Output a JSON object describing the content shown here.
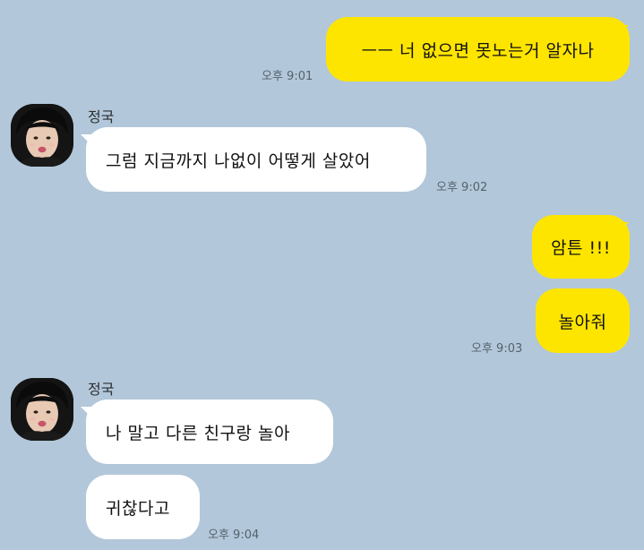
{
  "messages": {
    "m1": {
      "text": "ㅡㅡ 너 없으면 못노는거 알자나",
      "time": "오후 9:01"
    },
    "m2": {
      "sender": "정국",
      "text": "그럼 지금까지 나없이 어떻게 살았어",
      "time": "오후 9:02"
    },
    "m3": {
      "text": "암튼 !!!"
    },
    "m4": {
      "text": "놀아줘",
      "time": "오후 9:03"
    },
    "m5": {
      "sender": "정국",
      "text": "나 말고 다른 친구랑 놀아"
    },
    "m6": {
      "text": "귀찮다고",
      "time": "오후 9:04"
    }
  },
  "colors": {
    "background": "#b2c7d9",
    "my_bubble": "#fee500",
    "their_bubble": "#ffffff"
  },
  "icons": {
    "avatar": "profile-photo"
  }
}
